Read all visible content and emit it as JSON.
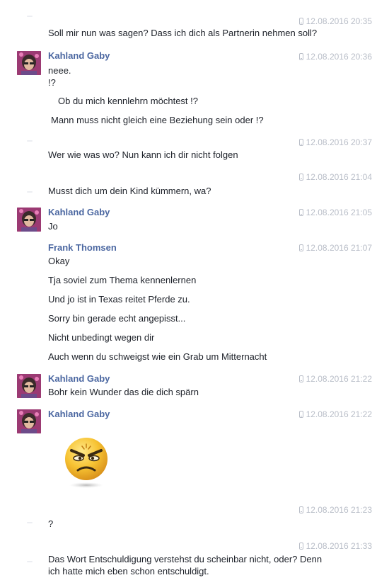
{
  "messages": [
    {
      "timestamp": "12.08.2016 20:35",
      "text": "Soll mir nun was sagen? Dass ich dich als Partnerin nehmen soll?"
    },
    {
      "name": "Kahland Gaby",
      "timestamp": "12.08.2016 20:36",
      "lines": [
        "neee.",
        "!?",
        "Ob du mich kennlehrn möchtest !?",
        "Mann muss nicht gleich eine Beziehung  sein oder !?"
      ]
    },
    {
      "timestamp": "12.08.2016 20:37",
      "text": "Wer wie was wo?  Nun kann ich dir nicht folgen"
    },
    {
      "timestamp": "12.08.2016 21:04",
      "text": "Musst dich um dein Kind kümmern, wa?"
    },
    {
      "name": "Kahland Gaby",
      "timestamp": "12.08.2016 21:05",
      "text": "Jo"
    },
    {
      "name": "Frank Thomsen",
      "timestamp": "12.08.2016 21:07",
      "lines": [
        "Okay",
        "Tja soviel zum Thema kennenlernen",
        "Und jo ist in Texas reitet Pferde zu.",
        "Sorry bin gerade echt angepisst...",
        "Nicht unbedingt wegen dir",
        "Auch wenn du schweigst wie ein Grab um Mitternacht"
      ]
    },
    {
      "name": "Kahland Gaby",
      "timestamp": "12.08.2016 21:22",
      "text": "Bohr kein Wunder das die dich spärn"
    },
    {
      "name": "Kahland Gaby",
      "timestamp": "12.08.2016 21:22",
      "sticker": "angry-face-emoji"
    },
    {
      "timestamp": "12.08.2016 21:23",
      "text": "?"
    },
    {
      "timestamp": "12.08.2016 21:33",
      "lines": [
        "Das Wort Entschuldigung verstehst du scheinbar nicht, oder? Denn",
        "ich hatte mich eben schon entschuldigt."
      ]
    }
  ],
  "colors": {
    "name": "#4b67a1",
    "timestamp": "#b9bec8",
    "text": "#1d2129"
  },
  "icons": {
    "timestamp_icon": "mobile-phone-icon"
  }
}
